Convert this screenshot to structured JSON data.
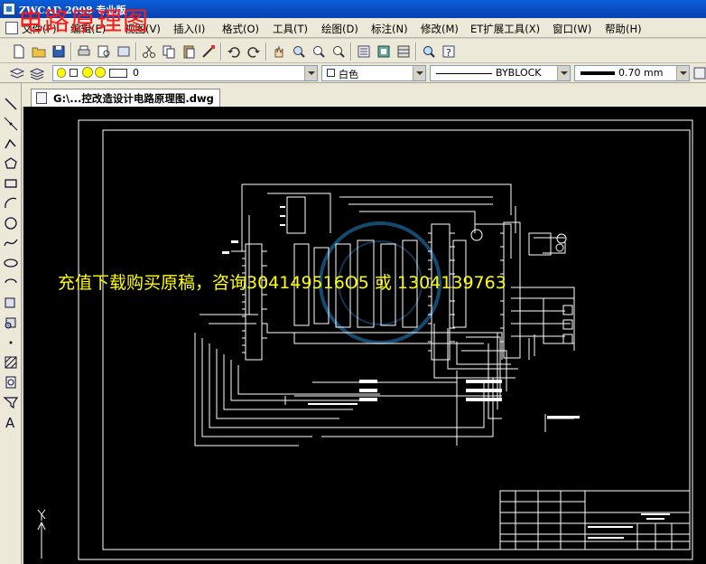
{
  "window": {
    "title": "ZWCAD 2008 专业版"
  },
  "overlay": {
    "title": "电路原理图",
    "promo": "充值下载购买原稿，咨询304149516O5 或 1304139763"
  },
  "menu": [
    "文件(F)",
    "编辑(E)",
    "视图(V)",
    "插入(I)",
    "格式(O)",
    "工具(T)",
    "绘图(D)",
    "标注(N)",
    "修改(M)",
    "ET扩展工具(X)",
    "窗口(W)",
    "帮助(H)"
  ],
  "layer_bar": {
    "layer_value": "0",
    "color_value": "白色",
    "linetype_value": "BYBLOCK",
    "lineweight_value": "0.70 mm"
  },
  "document_tab": {
    "label": "G:\\...控改造设计电路原理图.dwg"
  },
  "colors": {
    "titlebar": "#0a5fd8",
    "canvas": "#000000",
    "overlay_title": "#ff1a1a",
    "overlay_promo": "#ffff00"
  }
}
